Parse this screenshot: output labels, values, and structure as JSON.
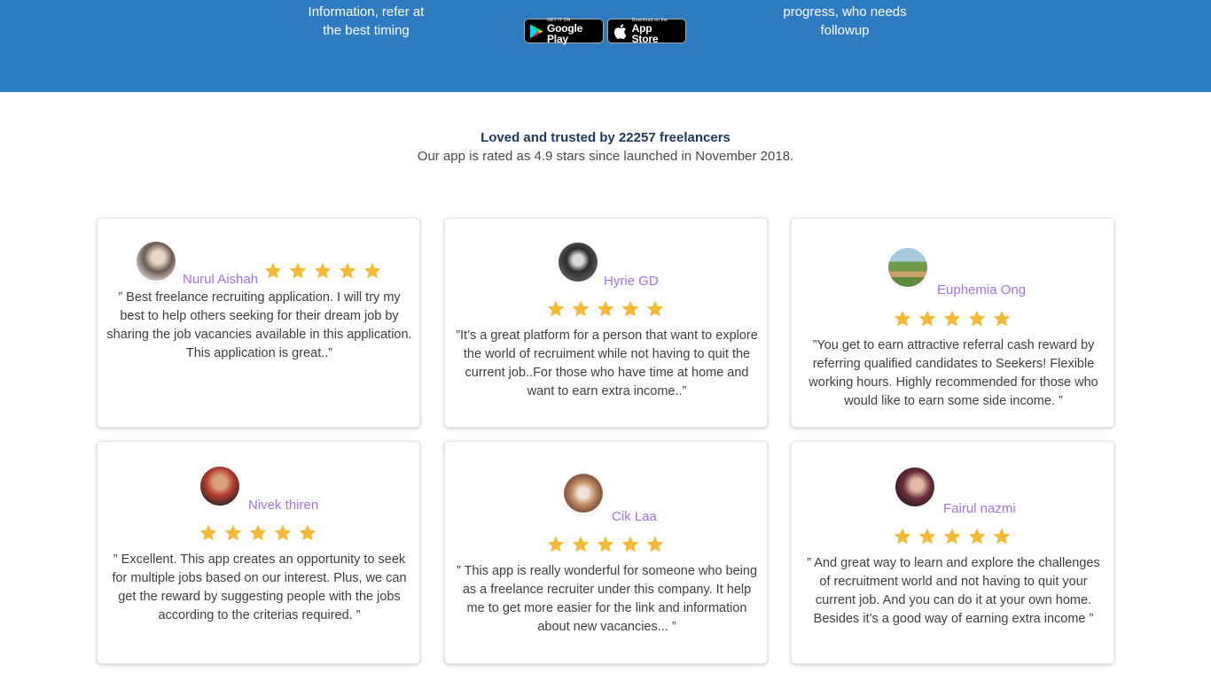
{
  "banner": {
    "left_text_line1": "Information, refer at",
    "left_text_line2": "the best timing",
    "right_text_line1": "progress, who needs",
    "right_text_line2": "followup",
    "google_play": {
      "small": "GET IT ON",
      "big": "Google Play"
    },
    "app_store": {
      "small": "Download on the",
      "big": "App Store"
    }
  },
  "intro": {
    "title": "Loved and trusted by 22257 freelancers",
    "subtitle": "Our app is rated as 4.9 stars since launched in November 2018."
  },
  "reviews": [
    {
      "name": "Nurul Aishah",
      "rating": 5,
      "text": "” Best freelance recruiting application. I will try my best to help others seeking for their dream job by sharing the job vacancies available in this application. This application is great..”"
    },
    {
      "name": "Hyrie GD",
      "rating": 5,
      "text": "”It’s a great platform for a person that want to explore the world of recruiment while not having to quit the current job..For those who have time at home and want to earn extra income..”"
    },
    {
      "name": "Euphemia Ong",
      "rating": 5,
      "text": "”You get to earn attractive referral cash reward by referring qualified candidates to Seekers! Flexible working hours. Highly recommended for those who would like to earn some side income. ”"
    },
    {
      "name": "Nivek thiren",
      "rating": 5,
      "text": "” Excellent. This app creates an opportunity to seek for multiple jobs based on our interest. Plus, we can get the reward by suggesting people with the jobs according to the criterias required. ”"
    },
    {
      "name": "Cik Laa",
      "rating": 5,
      "text": "” This app is really wonderful for someone who being as a freelance recruiter under this company. It help me to get more easier for the link and information about new vacancies... ”"
    },
    {
      "name": "Fairul nazmi",
      "rating": 5,
      "text": "” And great way to learn and explore the challenges of recruitment world and not having to quit your current job. And you can do it at your own home. Besides it’s a good way of earning extra income ”"
    }
  ],
  "colors": {
    "banner": "#2f7bc1",
    "name": "#a374db",
    "star": "#f5b935",
    "title": "#203a59"
  }
}
